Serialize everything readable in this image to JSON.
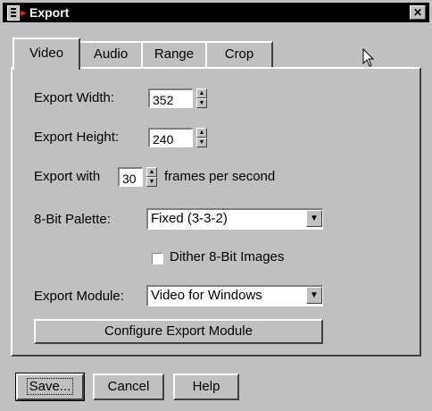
{
  "window": {
    "title": "Export",
    "close_label": "✕"
  },
  "tabs": [
    {
      "label": "Video",
      "active": true
    },
    {
      "label": "Audio",
      "active": false
    },
    {
      "label": "Range",
      "active": false
    },
    {
      "label": "Crop",
      "active": false
    }
  ],
  "video": {
    "width_label": "Export Width:",
    "width_value": "352",
    "height_label": "Export Height:",
    "height_value": "240",
    "fps_prefix": "Export with",
    "fps_value": "30",
    "fps_suffix": "frames per second",
    "palette_label": "8-Bit Palette:",
    "palette_value": "Fixed (3-3-2)",
    "dither_label": "Dither 8-Bit Images",
    "dither_checked": false,
    "module_label": "Export Module:",
    "module_value": "Video for Windows",
    "configure_label": "Configure Export Module"
  },
  "footer": {
    "save_label": "Save...",
    "cancel_label": "Cancel",
    "help_label": "Help"
  }
}
